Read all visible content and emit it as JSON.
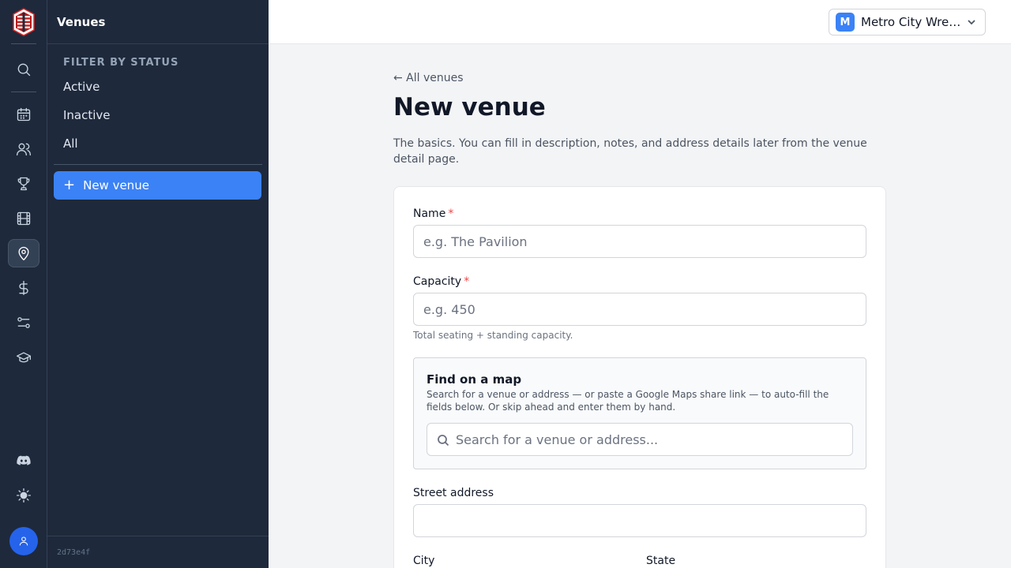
{
  "rail": {
    "items": [
      {
        "name": "search-icon",
        "active": false
      },
      {
        "name": "calendar-icon",
        "active": false
      },
      {
        "name": "users-icon",
        "active": false
      },
      {
        "name": "trophy-icon",
        "active": false
      },
      {
        "name": "film-icon",
        "active": false
      },
      {
        "name": "map-pin-icon",
        "active": true
      },
      {
        "name": "dollar-icon",
        "active": false
      },
      {
        "name": "sliders-icon",
        "active": false
      },
      {
        "name": "graduation-cap-icon",
        "active": false
      },
      {
        "name": "discord-icon",
        "active": false
      },
      {
        "name": "sun-icon",
        "active": false
      }
    ],
    "avatar_icon": "user-icon",
    "accent": "#2563eb"
  },
  "sidebar": {
    "title": "Venues",
    "filter_label": "FILTER BY STATUS",
    "filters": [
      "Active",
      "Inactive",
      "All"
    ],
    "new_button": "New venue",
    "version": "2d73e4f"
  },
  "header": {
    "org_initial": "M",
    "org_name": "Metro City Wrestling"
  },
  "main": {
    "back_link": "← All venues",
    "title": "New venue",
    "subtitle": "The basics. You can fill in description, notes, and address details later from the venue detail page.",
    "form": {
      "name_label": "Name",
      "name_placeholder": "e.g. The Pavilion",
      "required_mark": "*",
      "capacity_label": "Capacity",
      "capacity_placeholder": "e.g. 450",
      "capacity_hint": "Total seating + standing capacity.",
      "map": {
        "title": "Find on a map",
        "description": "Search for a venue or address — or paste a Google Maps share link — to auto-fill the fields below. Or skip ahead and enter them by hand.",
        "search_placeholder": "Search for a venue or address..."
      },
      "street_label": "Street address",
      "street_value": "",
      "city_label": "City",
      "state_label": "State"
    }
  },
  "colors": {
    "primary": "#3b82f6",
    "sidebar_bg": "#1e293b",
    "required": "#ef4444"
  }
}
